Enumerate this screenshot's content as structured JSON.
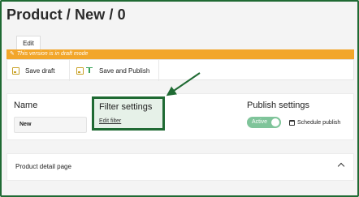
{
  "page": {
    "title": "Product / New / 0"
  },
  "tabs": [
    {
      "label": "Edit"
    }
  ],
  "banner": {
    "text": "This version is in draft mode",
    "icon": "pencil-icon"
  },
  "toolbar": {
    "save_draft_label": "Save draft",
    "save_publish_label": "Save and Publish"
  },
  "sections": {
    "name": {
      "title": "Name",
      "value": "New"
    },
    "filter": {
      "title": "Filter settings",
      "link": "Edit filter"
    },
    "publish": {
      "title": "Publish settings",
      "toggle_label": "Active",
      "schedule_label": "Schedule publish"
    }
  },
  "detail_panel": {
    "title": "Product detail page"
  },
  "colors": {
    "highlight_border": "#1f6a33",
    "highlight_fill": "#e6f1e8",
    "banner": "#f2a62a",
    "toggle_on": "#7fc49a"
  }
}
